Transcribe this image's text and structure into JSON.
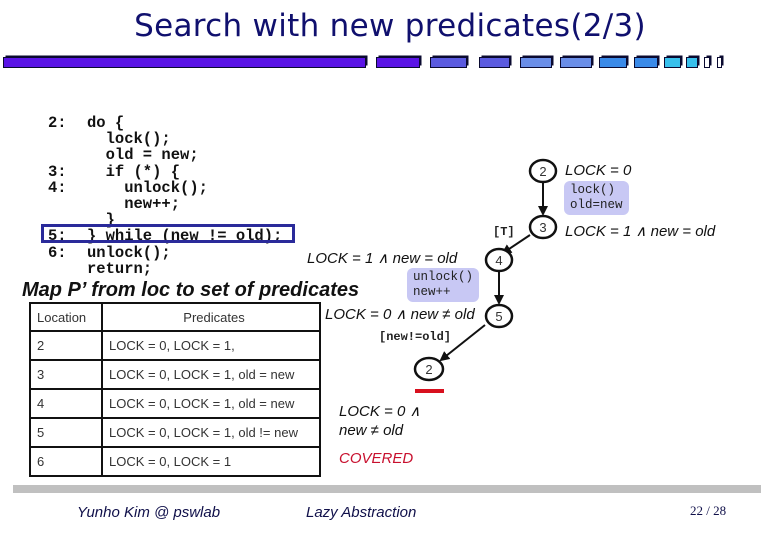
{
  "slide": {
    "title": "Search with new predicates(2/3)",
    "progress": {
      "segments_total": 14,
      "current_index": 2
    }
  },
  "code": {
    "line_numbers": [
      "2:",
      "",
      "",
      "3:",
      "4:",
      "",
      "",
      "5:",
      "6:",
      ""
    ],
    "lines": [
      "do {",
      "  lock();",
      "  old = new;",
      "  if (*) {",
      "    unlock();",
      "    new++;",
      "  }",
      "} while (new != old);",
      "unlock();",
      "return;"
    ],
    "highlighted_line": "5"
  },
  "map": {
    "title": "Map P’ from loc to set of predicates",
    "headers": [
      "Location",
      "Predicates"
    ],
    "rows": [
      {
        "location": "2",
        "predicates": "LOCK = 0, LOCK = 1,"
      },
      {
        "location": "3",
        "predicates": "LOCK = 0, LOCK = 1, old = new"
      },
      {
        "location": "4",
        "predicates": "LOCK = 0, LOCK = 1, old = new"
      },
      {
        "location": "5",
        "predicates": "LOCK = 0, LOCK = 1, old != new"
      },
      {
        "location": "6",
        "predicates": "LOCK = 0, LOCK = 1"
      }
    ]
  },
  "graph": {
    "nodes": [
      {
        "id": "n2a",
        "label": "2",
        "formula": "LOCK = 0"
      },
      {
        "id": "n3",
        "label": "3",
        "formula": "LOCK = 1 ∧ new = old"
      },
      {
        "id": "n4",
        "label": "4",
        "formula": "LOCK = 1 ∧ new = old"
      },
      {
        "id": "n5",
        "label": "5",
        "formula": "LOCK = 0 ∧ new ≠ old"
      },
      {
        "id": "n2b",
        "label": "2",
        "formula_line1": "LOCK = 0 ∧",
        "formula_line2": "new ≠ old",
        "status": "COVERED"
      }
    ],
    "edges": [
      {
        "from": "n2a",
        "to": "n3",
        "actions": [
          "lock()",
          "old=new"
        ]
      },
      {
        "from": "n3",
        "to": "n4",
        "condition": "[T]"
      },
      {
        "from": "n4",
        "to": "n5",
        "actions": [
          "unlock()",
          "new++"
        ]
      },
      {
        "from": "n5",
        "to": "n2b",
        "condition": "[new!=old]"
      }
    ],
    "covered_color": "#c8102e"
  },
  "footer": {
    "author": "Yunho Kim @ pswlab",
    "topic": "Lazy Abstraction",
    "page": "22 / 28"
  }
}
